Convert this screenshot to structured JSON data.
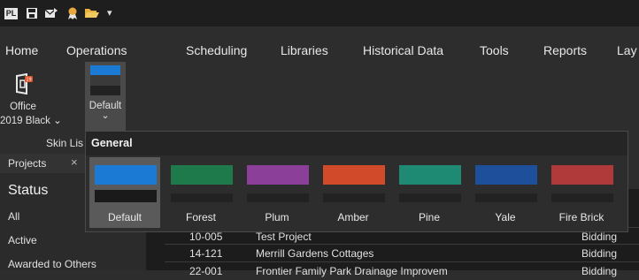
{
  "qat": {
    "app_logo_text": "PL",
    "dropdown_caret": "▾"
  },
  "menu": [
    "Home",
    "Operations",
    "Scheduling",
    "Libraries",
    "Historical Data",
    "Tools",
    "Reports",
    "Lay"
  ],
  "ribbon": {
    "office_skin": {
      "line1": "Office",
      "line2": "2019 Black",
      "caret": "⌄"
    },
    "palette_button": {
      "label": "Default",
      "caret": "⌄"
    },
    "group_label": "Skin Lis"
  },
  "left_panel": {
    "tab_label": "Projects",
    "tab_close": "×",
    "heading": "Status",
    "items": [
      "All",
      "Active",
      "Awarded to Others"
    ]
  },
  "gallery": {
    "header": "General",
    "swatches": [
      {
        "label": "Default",
        "color": "#1a7ad4",
        "selected": true
      },
      {
        "label": "Forest",
        "color": "#1e7a4a",
        "selected": false
      },
      {
        "label": "Plum",
        "color": "#8c3f98",
        "selected": false
      },
      {
        "label": "Amber",
        "color": "#d14a2a",
        "selected": false
      },
      {
        "label": "Pine",
        "color": "#1f8a74",
        "selected": false
      },
      {
        "label": "Yale",
        "color": "#1e4f9a",
        "selected": false
      },
      {
        "label": "Fire Brick",
        "color": "#b03a3a",
        "selected": false
      }
    ]
  },
  "grid": {
    "rows": [
      {
        "id": "10-005",
        "name": "Test Project",
        "status": "Bidding"
      },
      {
        "id": "14-121",
        "name": "Merrill Gardens Cottages",
        "status": "Bidding"
      },
      {
        "id": "22-001",
        "name": "Frontier Family Park Drainage Improvem",
        "status": "Bidding"
      }
    ]
  }
}
